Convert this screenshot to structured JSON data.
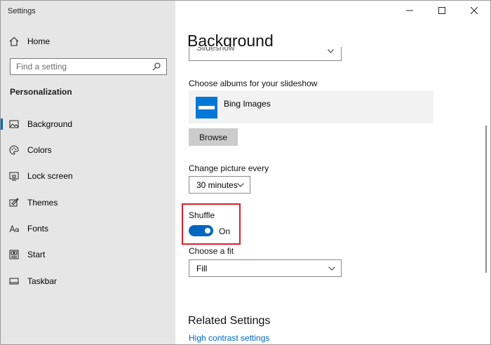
{
  "window": {
    "title": "Settings"
  },
  "sidebar": {
    "home_label": "Home",
    "search_placeholder": "Find a setting",
    "section_title": "Personalization",
    "items": [
      {
        "label": "Background",
        "icon": "image-icon",
        "active": true
      },
      {
        "label": "Colors",
        "icon": "palette-icon",
        "active": false
      },
      {
        "label": "Lock screen",
        "icon": "lock-screen-icon",
        "active": false
      },
      {
        "label": "Themes",
        "icon": "themes-icon",
        "active": false
      },
      {
        "label": "Fonts",
        "icon": "fonts-icon",
        "active": false
      },
      {
        "label": "Start",
        "icon": "start-icon",
        "active": false
      },
      {
        "label": "Taskbar",
        "icon": "taskbar-icon",
        "active": false
      }
    ]
  },
  "main": {
    "page_title": "Background",
    "background_type_value": "Slideshow",
    "albums_label": "Choose albums for your slideshow",
    "album_name": "Bing Images",
    "browse_label": "Browse",
    "change_picture_label": "Change picture every",
    "change_picture_value": "30 minutes",
    "shuffle_label": "Shuffle",
    "shuffle_state": "On",
    "fit_label": "Choose a fit",
    "fit_value": "Fill",
    "related_title": "Related Settings",
    "related_link": "High contrast settings"
  },
  "colors": {
    "accent": "#0067c0",
    "highlight": "#e11d2a",
    "sidebar_bg": "#e6e6e6"
  }
}
